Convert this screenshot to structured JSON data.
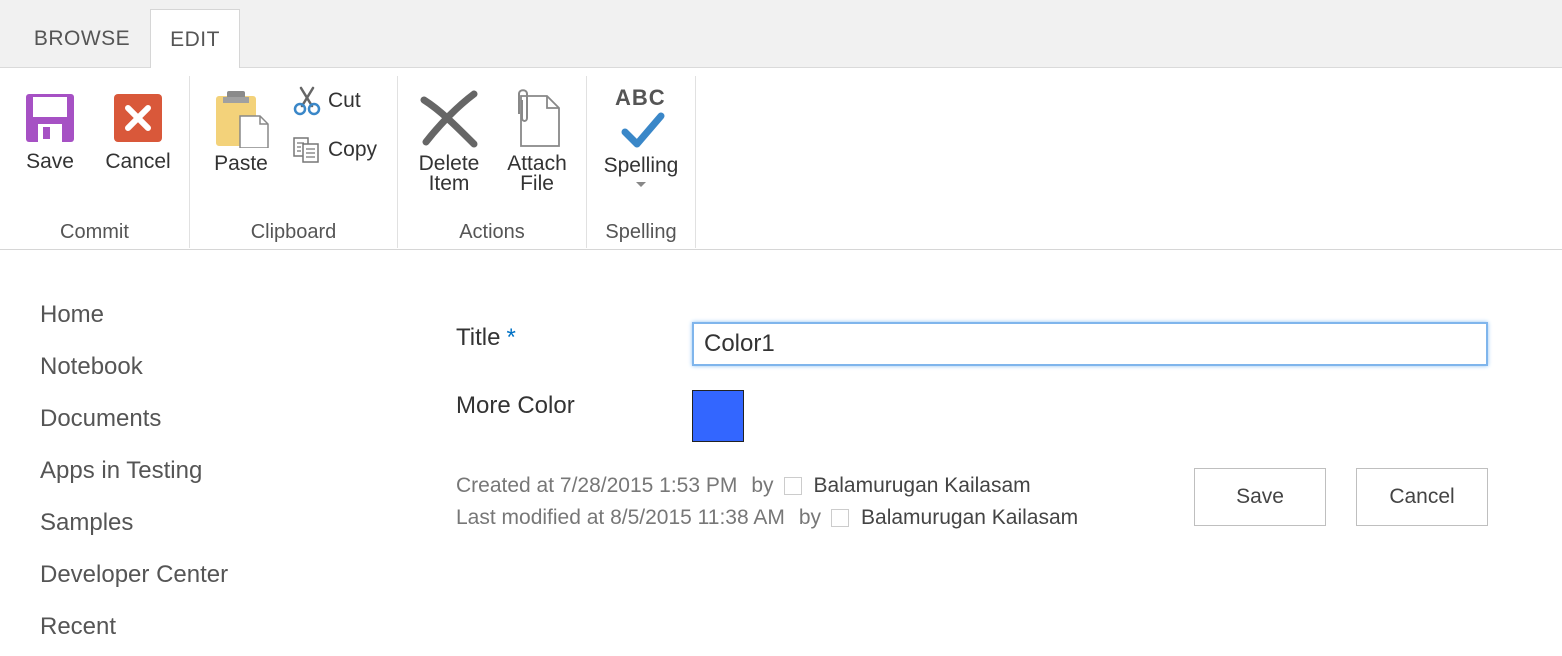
{
  "tabs": [
    {
      "label": "BROWSE"
    },
    {
      "label": "EDIT",
      "active": true
    }
  ],
  "ribbon": {
    "commit": {
      "label": "Commit",
      "save": "Save",
      "cancel": "Cancel"
    },
    "clipboard": {
      "label": "Clipboard",
      "paste": "Paste",
      "cut": "Cut",
      "copy": "Copy"
    },
    "actions": {
      "label": "Actions",
      "delete_line1": "Delete",
      "delete_line2": "Item",
      "attach_line1": "Attach",
      "attach_line2": "File"
    },
    "spelling": {
      "label": "Spelling",
      "button": "Spelling",
      "icon_text": "ABC"
    }
  },
  "nav": {
    "items": [
      "Home",
      "Notebook",
      "Documents",
      "Apps in Testing",
      "Samples",
      "Developer Center",
      "Recent"
    ]
  },
  "form": {
    "title_label": "Title",
    "required_mark": "*",
    "title_value": "Color1",
    "color_label": "More Color",
    "color_value": "#3366ff",
    "created": {
      "text": "Created at 7/28/2015 1:53 PM",
      "by": "by",
      "user": "Balamurugan Kailasam"
    },
    "modified": {
      "text": "Last modified at 8/5/2015 11:38 AM",
      "by": "by",
      "user": "Balamurugan Kailasam"
    },
    "save_button": "Save",
    "cancel_button": "Cancel"
  },
  "icons": {
    "save": "save-icon",
    "cancel": "cancel-icon",
    "paste": "paste-icon",
    "cut": "cut-icon",
    "copy": "copy-icon",
    "delete": "delete-icon",
    "attach": "attach-file-icon",
    "spelling": "spelling-icon"
  },
  "colors": {
    "accent": "#0072c6",
    "save_icon": "#a651c4",
    "cancel_icon": "#d9583a",
    "checkmark": "#3a87c8"
  }
}
